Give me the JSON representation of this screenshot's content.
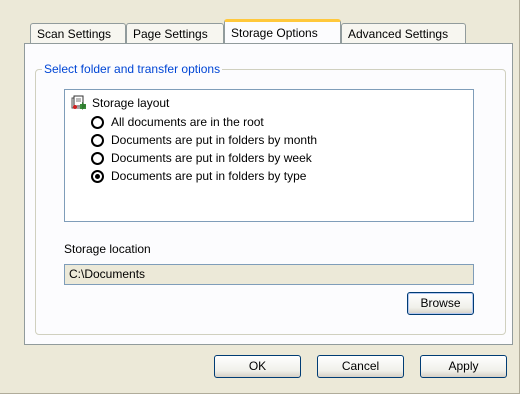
{
  "tabs": [
    {
      "label": "Scan Settings"
    },
    {
      "label": "Page Settings"
    },
    {
      "label": "Storage Options"
    },
    {
      "label": "Advanced Settings"
    }
  ],
  "active_tab": "Storage Options",
  "group": {
    "title": "Select folder and transfer options"
  },
  "storage_layout": {
    "heading": "Storage layout",
    "options": [
      {
        "label": "All documents are in the root",
        "checked": false
      },
      {
        "label": "Documents are put in folders by month",
        "checked": false
      },
      {
        "label": "Documents are put in folders by week",
        "checked": false
      },
      {
        "label": "Documents are put in folders by type",
        "checked": true
      }
    ]
  },
  "storage_location": {
    "label": "Storage location",
    "value": "C:\\Documents",
    "browse_label": "Browse"
  },
  "buttons": {
    "ok": "OK",
    "cancel": "Cancel",
    "apply": "Apply"
  }
}
